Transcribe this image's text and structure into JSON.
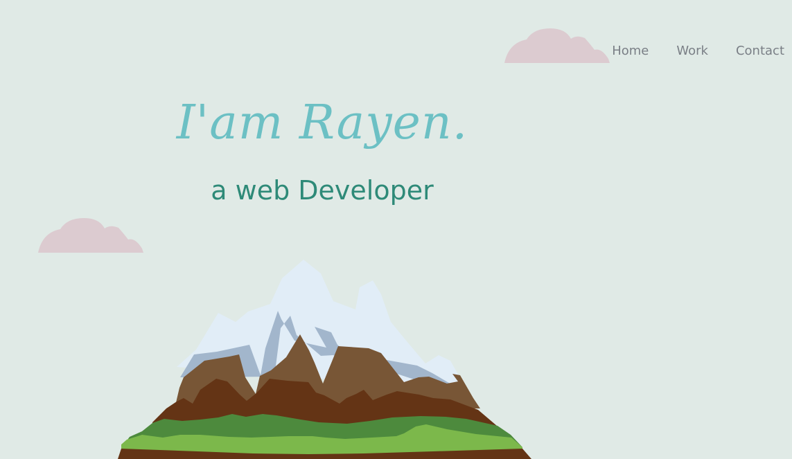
{
  "nav": {
    "items": [
      {
        "label": "Home"
      },
      {
        "label": "Work"
      },
      {
        "label": "Contact"
      }
    ]
  },
  "hero": {
    "title": "I'am Rayen.",
    "subtitle": "a web Developer"
  },
  "colors": {
    "background": "#e0eae6",
    "title": "#6cc0c4",
    "subtitle": "#2e8a78",
    "nav_text": "#7a7f86",
    "cloud": "#dccbd0",
    "snow": "#e1edf7",
    "snow_shadow": "#a2b6cc",
    "rock_light": "#785636",
    "rock_dark": "#643415",
    "grass_dark": "#4d8a3d",
    "grass_light": "#7cb84b"
  },
  "illustrations": {
    "clouds": [
      "cloud-icon",
      "cloud-icon"
    ],
    "mountain": "mountain-illustration"
  }
}
